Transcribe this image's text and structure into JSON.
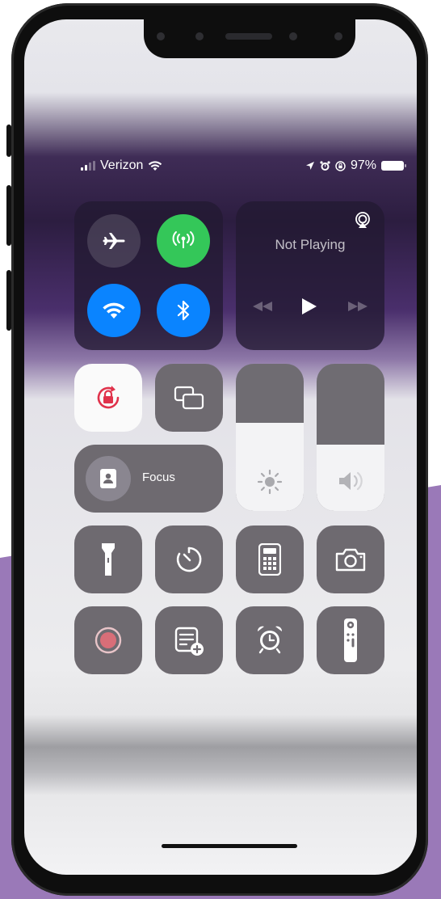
{
  "status_bar": {
    "carrier": "Verizon",
    "battery_percent": "97%",
    "signal_bars_filled": 2,
    "signal_bars_total": 4
  },
  "connectivity": {
    "airplane_mode": {
      "state": "off",
      "icon": "airplane-icon"
    },
    "cellular_data": {
      "state": "on",
      "icon": "antenna-icon",
      "color": "#34c759"
    },
    "wifi": {
      "state": "on",
      "icon": "wifi-icon",
      "color": "#0a84ff"
    },
    "bluetooth": {
      "state": "on",
      "icon": "bluetooth-icon",
      "color": "#0a84ff"
    }
  },
  "media": {
    "status": "Not Playing",
    "airplay_icon": "airplay-icon"
  },
  "controls": {
    "focus_label": "Focus",
    "brightness_level": 0.6,
    "volume_level": 0.45
  },
  "colors": {
    "accent_green": "#34c759",
    "accent_blue": "#0a84ff",
    "rotation_lock_red": "#e0324b",
    "background_purple": "#9a79b8"
  }
}
